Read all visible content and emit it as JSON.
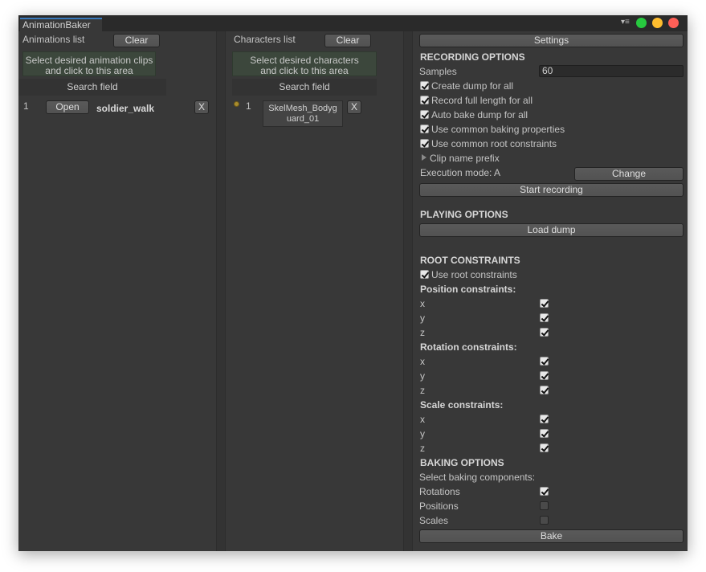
{
  "window": {
    "tab_title": "AnimationBaker"
  },
  "colors": {
    "dot_green": "#27c93f",
    "dot_yellow": "#ffbd2e",
    "dot_red": "#ff5f57",
    "accent": "#3a79bb"
  },
  "animations": {
    "header": "Animations list",
    "clear_label": "Clear",
    "dropzone_line1": "Select desired animation clips",
    "dropzone_line2": "and click to this area",
    "search_label": "Search field",
    "items": [
      {
        "index": "1",
        "open_label": "Open",
        "name": "soldier_walk",
        "remove_label": "X"
      }
    ]
  },
  "characters": {
    "header": "Characters list",
    "clear_label": "Clear",
    "dropzone_line1": "Select desired characters",
    "dropzone_line2": "and click to this area",
    "search_label": "Search field",
    "items": [
      {
        "index": "1",
        "name_line1": "SkelMesh_Bodyg",
        "name_line2": "uard_01",
        "remove_label": "X"
      }
    ]
  },
  "settings": {
    "settings_button": "Settings",
    "recording": {
      "header": "RECORDING OPTIONS",
      "samples_label": "Samples",
      "samples_value": "60",
      "create_dump": "Create dump for all",
      "record_full_length": "Record full length for all",
      "auto_bake": "Auto bake dump for all",
      "common_baking": "Use common baking properties",
      "common_root": "Use common root constraints",
      "clip_prefix": "Clip name prefix",
      "execution_mode": "Execution mode: A",
      "change_button": "Change",
      "start_button": "Start recording"
    },
    "playing": {
      "header": "PLAYING OPTIONS",
      "load_button": "Load dump"
    },
    "root": {
      "header": "ROOT CONSTRAINTS",
      "use_root": "Use root constraints",
      "position_header": "Position constraints:",
      "rotation_header": "Rotation constraints:",
      "scale_header": "Scale constraints:",
      "x": "x",
      "y": "y",
      "z": "z"
    },
    "baking": {
      "header": "BAKING OPTIONS",
      "select_label": "Select baking components:",
      "rotations": "Rotations",
      "positions": "Positions",
      "scales": "Scales",
      "bake_button": "Bake"
    }
  }
}
